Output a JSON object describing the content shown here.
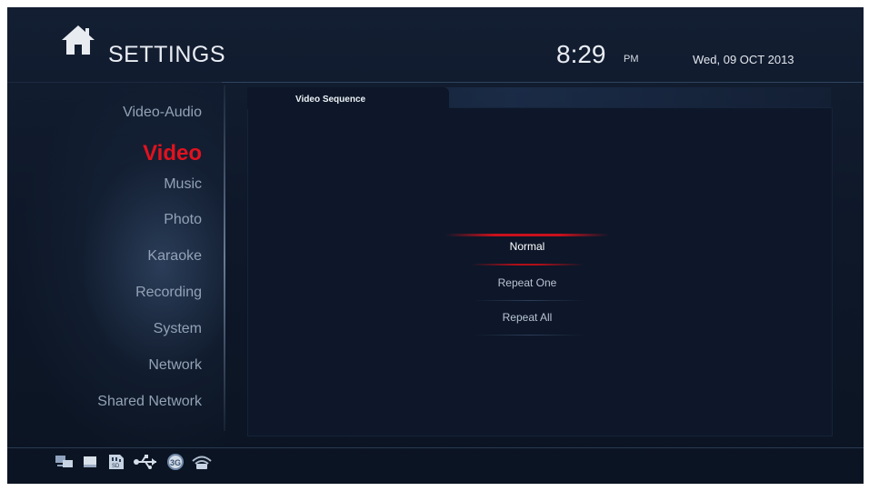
{
  "header": {
    "title": "SETTINGS",
    "time": "8:29",
    "ampm": "PM",
    "date": "Wed, 09 OCT 2013",
    "icon": "home-icon"
  },
  "sidebar": {
    "items": [
      {
        "label": "Video-Audio",
        "active": false
      },
      {
        "label": "Video",
        "active": true
      },
      {
        "label": "Music",
        "active": false
      },
      {
        "label": "Photo",
        "active": false
      },
      {
        "label": "Karaoke",
        "active": false
      },
      {
        "label": "Recording",
        "active": false
      },
      {
        "label": "System",
        "active": false
      },
      {
        "label": "Network",
        "active": false
      },
      {
        "label": "Shared Network",
        "active": false
      }
    ]
  },
  "panel": {
    "tab_label": "Video Sequence",
    "options": [
      "Normal",
      "Repeat One",
      "Repeat All"
    ],
    "selected": "Normal"
  },
  "status_icons": [
    "network-icon",
    "storage-icon",
    "sd-card-icon",
    "usb-icon",
    "3g-icon",
    "wifi-icon"
  ],
  "colors": {
    "accent": "#e1121e",
    "background": "#0e1829",
    "text": "#e9edf3"
  }
}
